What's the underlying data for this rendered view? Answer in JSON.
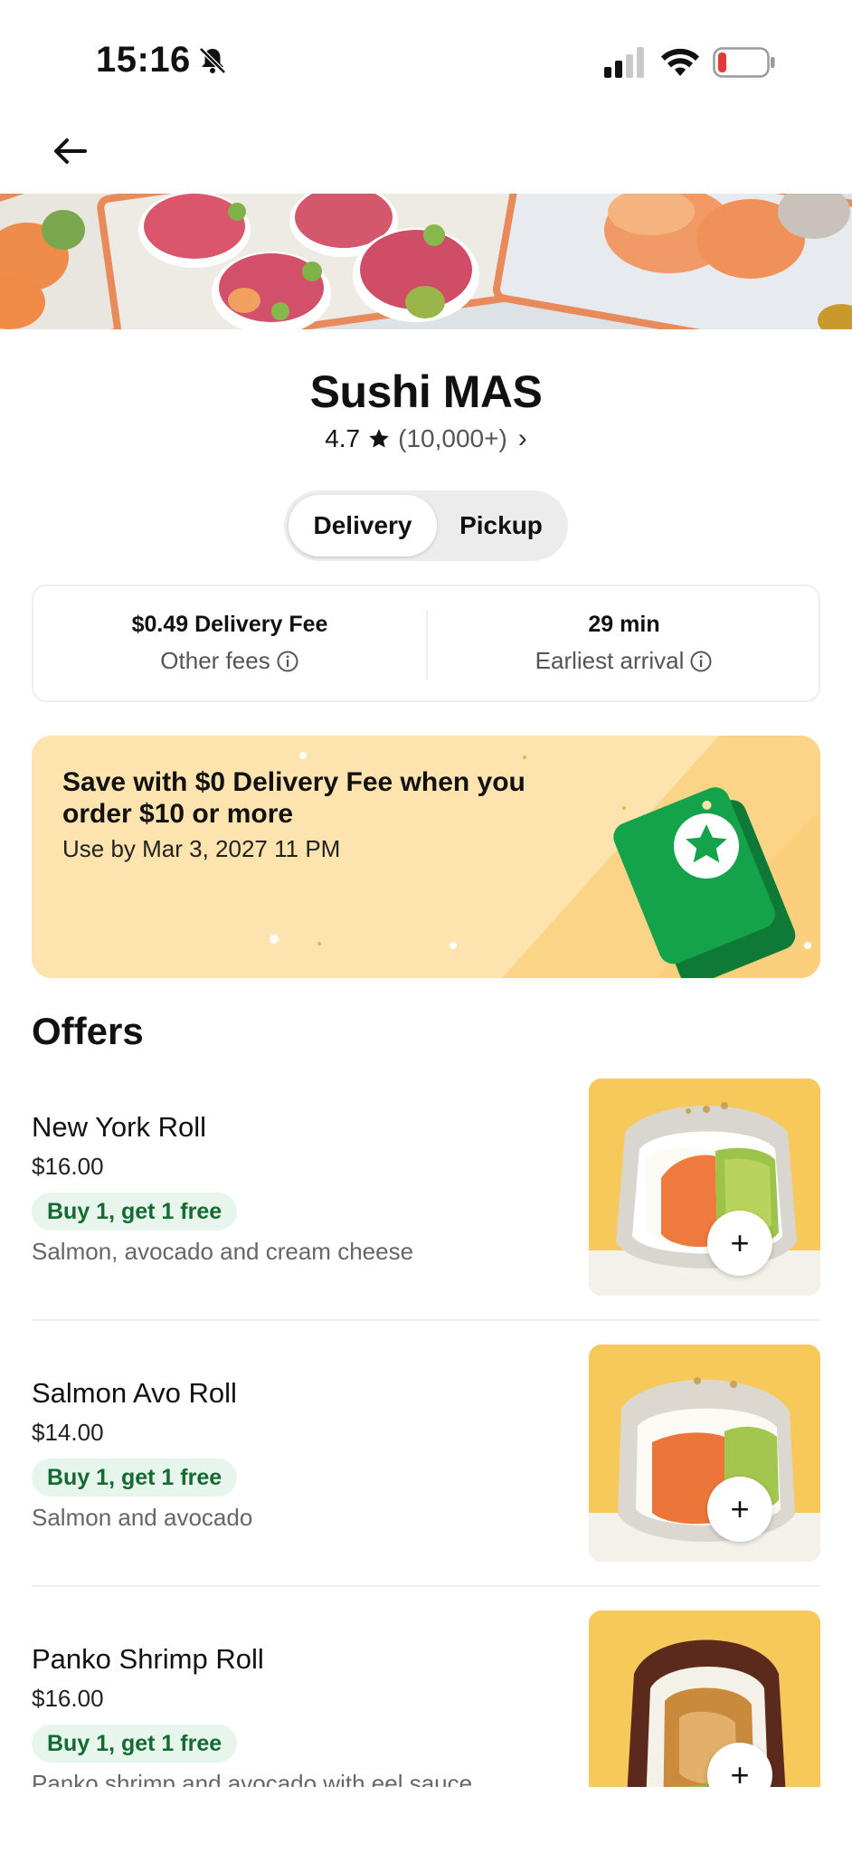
{
  "status_bar": {
    "time": "15:16",
    "icons": [
      "bell-slash-icon",
      "cellular-signal-icon",
      "wifi-icon",
      "battery-low-icon"
    ],
    "battery_color": "#e53935"
  },
  "nav": {
    "back_icon": "arrow-left-icon"
  },
  "restaurant": {
    "name": "Sushi MAS",
    "rating": "4.7",
    "rating_count": "(10,000+)",
    "chevron": "›"
  },
  "mode_toggle": {
    "options": [
      "Delivery",
      "Pickup"
    ],
    "selected": "Delivery"
  },
  "info_card": {
    "delivery_fee": "$0.49 Delivery Fee",
    "other_fees": "Other fees",
    "eta": "29 min",
    "earliest_arrival": "Earliest arrival"
  },
  "promo": {
    "title": "Save with $0 Delivery Fee when you order $10 or more",
    "subtitle": "Use by Mar 3, 2027 11 PM",
    "background": "#fde3ad",
    "accent": "#14a34a"
  },
  "offers": {
    "title": "Offers",
    "items": [
      {
        "name": "New York Roll",
        "price": "$16.00",
        "badge": "Buy 1, get 1 free",
        "description": "Salmon, avocado and cream cheese",
        "add": "+"
      },
      {
        "name": "Salmon Avo Roll",
        "price": "$14.00",
        "badge": "Buy 1, get 1 free",
        "description": "Salmon and avocado",
        "add": "+"
      },
      {
        "name": "Panko Shrimp Roll",
        "price": "$16.00",
        "badge": "Buy 1, get 1 free",
        "description": "Panko shrimp and avocado with eel sauce",
        "add": "+"
      }
    ],
    "badge_color": "#136b32"
  }
}
